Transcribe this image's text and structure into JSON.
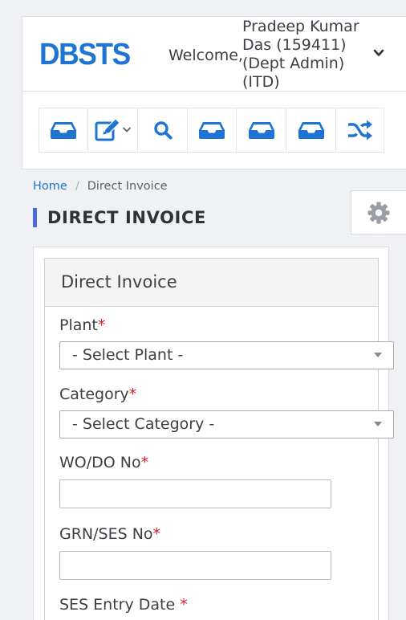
{
  "header": {
    "logo": "DBSTS",
    "welcome": "Welcome,",
    "user_name": "Pradeep Kumar Das (159411) (Dept Admin) (ITD)"
  },
  "toolbar": {
    "buttons": [
      {
        "icon": "inbox-icon"
      },
      {
        "icon": "edit-icon",
        "dropdown": true
      },
      {
        "icon": "search-icon"
      },
      {
        "icon": "inbox-icon"
      },
      {
        "icon": "inbox-icon"
      },
      {
        "icon": "inbox-icon"
      },
      {
        "icon": "shuffle-icon"
      }
    ]
  },
  "breadcrumb": {
    "home": "Home",
    "separator": "/",
    "current": "Direct Invoice"
  },
  "page": {
    "title": "DIRECT INVOICE"
  },
  "form": {
    "card_title": "Direct Invoice",
    "required_marker": "*",
    "plant": {
      "label": "Plant",
      "placeholder": "- Select Plant -"
    },
    "category": {
      "label": "Category",
      "placeholder": "- Select Category -"
    },
    "wo_do": {
      "label": "WO/DO No",
      "value": ""
    },
    "grn_ses": {
      "label": "GRN/SES No",
      "value": ""
    },
    "ses_entry_date": {
      "label": "SES Entry Date "
    }
  },
  "colors": {
    "brand": "#1e74d3",
    "accent_bar": "#4a6bdc",
    "required": "#d32028",
    "icon": "#1e74d3"
  }
}
